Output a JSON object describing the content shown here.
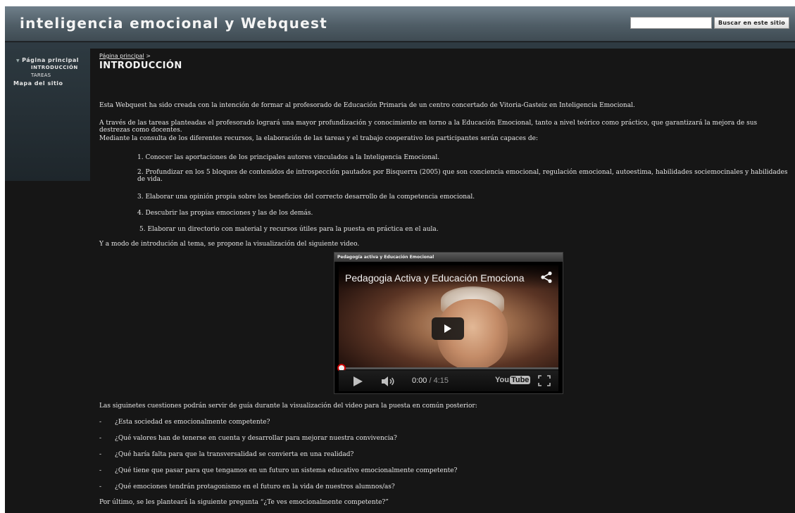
{
  "header": {
    "site_title": "inteligencia emocional y Webquest",
    "search_placeholder": "",
    "search_button": "Buscar en este sitio"
  },
  "sidebar": {
    "items": [
      {
        "label": "Página principal"
      },
      {
        "label": "INTRODUCCIÓN"
      },
      {
        "label": "TAREAS"
      },
      {
        "label": "Mapa del sitio"
      }
    ]
  },
  "breadcrumb": {
    "link": "Página principal",
    "separator": ">"
  },
  "page": {
    "title": "INTRODUCCIÓN",
    "p1": "Esta Webquest ha sido creada con la intención de formar al profesorado de Educación Primaria de un centro concertado de Vitoria-Gasteiz en Inteligencia Emocional.",
    "p2": "A través de las tareas planteadas el profesorado logrará una mayor profundización y conocimiento en torno a la Educación Emocional, tanto a nivel teórico como práctico, que garantizará la mejora de sus destrezas como docentes.",
    "p3": "Mediante la consulta de los diferentes recursos, la elaboración de las tareas y el trabajo cooperativo los participantes serán capaces de:",
    "list": [
      "1. Conocer las aportaciones de los principales autores vinculados a la Inteligencia Emocional.",
      "2. Profundizar en los 5 bloques de contenidos de introspección pautados por Bisquerra (2005) que son conciencia emocional, regulación emocional, autoestima, habilidades sociemocinales y habilidades de vida.",
      "3. Elaborar una opinión propia sobre los beneficios del correcto desarrollo de la competencia emocional.",
      "4. Descubrir las propias emociones y las de los demás.",
      "5. Elaborar un directorio con material y recursos útiles para la puesta en práctica en el aula."
    ],
    "video_intro": "Y a modo de introdución al tema, se propone la visualización del siguiente video.",
    "questions_intro": "Las siguinetes cuestiones podrán servir de guía durante la visualización del video para la puesta en común posterior:",
    "questions": [
      "¿Esta sociedad es emocionalmente competente?",
      "¿Qué valores han de tenerse en cuenta y desarrollar para mejorar nuestra convivencia?",
      "¿Qué haría falta para que la transversalidad se convierta en una realidad?",
      "¿Qué tiene que pasar para que tengamos en un futuro un sistema educativo emocionalmente competente?",
      "¿Qué emociones tendrán protagonismo en el futuro en la vida de nuestros alumnos/as?"
    ],
    "question_dash": "-",
    "closing": "Por último, se les planteará la siguiente pregunta “¿Te ves emocionalmente competente?”"
  },
  "video": {
    "frame_title": "Pedagogía activa y Educación Emocional",
    "overlay_title": "Pedagogia Activa y Educación Emociona",
    "current_time": "0:00",
    "duration": "/ 4:15",
    "logo_you": "You",
    "logo_tube": "Tube",
    "progress": 0
  },
  "icons": {
    "share": "share-icon",
    "play": "play-icon",
    "volume": "volume-icon",
    "fullscreen": "fullscreen-icon",
    "caret": "caret-down-icon"
  }
}
